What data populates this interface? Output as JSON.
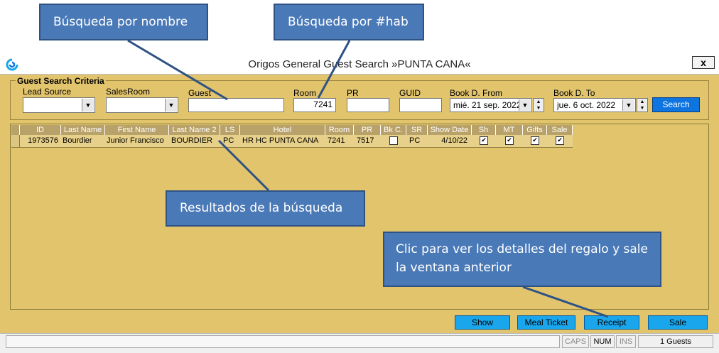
{
  "window": {
    "title": "Origos General Guest Search »PUNTA CANA«",
    "close_label": "x"
  },
  "criteria": {
    "group_title": "Guest Search Criteria",
    "lead_source_label": "Lead Source",
    "lead_source_value": "",
    "salesroom_label": "SalesRoom",
    "salesroom_value": "",
    "guest_label": "Guest",
    "guest_value": "",
    "room_label": "Room",
    "room_value": "7241",
    "pr_label": "PR",
    "pr_value": "",
    "guid_label": "GUID",
    "guid_value": "",
    "book_from_label": "Book D. From",
    "book_from_value": "mié.  21 sep.  2022",
    "book_to_label": "Book D. To",
    "book_to_value": "jue.   6  oct.  2022",
    "search_label": "Search"
  },
  "grid": {
    "columns": [
      "ID",
      "Last Name",
      "First Name",
      "Last Name 2",
      "LS",
      "Hotel",
      "Room",
      "PR",
      "Bk C.",
      "SR",
      "Show Date",
      "Sh",
      "MT",
      "Gifts",
      "Sale"
    ],
    "rows": [
      {
        "id": "1973576",
        "last_name": "Bourdier",
        "first_name": "Junior Francisco",
        "last_name2": "BOURDIER",
        "ls": "PC",
        "hotel": "HR HC PUNTA CANA",
        "room": "7241",
        "pr": "7517",
        "bkc": false,
        "sr": "PC",
        "show_date": "4/10/22",
        "sh": true,
        "mt": true,
        "gifts": true,
        "sale": true
      }
    ],
    "check_mark": "✔"
  },
  "buttons": {
    "show": "Show",
    "meal_ticket": "Meal Ticket",
    "receipt": "Receipt",
    "sale": "Sale"
  },
  "status": {
    "caps": "CAPS",
    "num": "NUM",
    "ins": "INS",
    "guests": "1 Guests"
  },
  "callouts": {
    "name_search": "Búsqueda por nombre",
    "room_search": "Búsqueda por #hab",
    "results": "Resultados de la búsqueda",
    "receipt_hint": "Clic para ver los detalles del regalo y sale la ventana anterior"
  },
  "colors": {
    "window_bg": "#e1c46c",
    "callout_bg": "#4a79b8",
    "button_bg": "#1aa6ec",
    "search_bg": "#0d74e0"
  },
  "icons": {
    "app": "origos-app-icon",
    "dropdown": "chevron-down-icon",
    "spin_up": "spin-up-icon",
    "spin_down": "spin-down-icon",
    "check": "check-icon"
  }
}
